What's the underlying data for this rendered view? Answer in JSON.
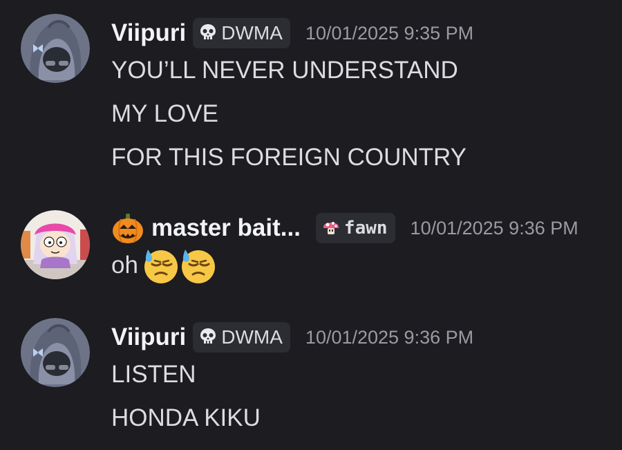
{
  "messages": [
    {
      "author": "Viipuri",
      "tag": "DWMA",
      "tag_icon": "skull-icon",
      "timestamp": "10/01/2025 9:35 PM",
      "lines": [
        "YOU’LL NEVER UNDERSTAND",
        "MY LOVE",
        "FOR THIS FOREIGN COUNTRY"
      ]
    },
    {
      "author_prefix_icon": "jack-o-lantern-icon",
      "author": "master bait...",
      "tag": "fawn",
      "tag_icon": "mushroom-icon",
      "timestamp": "10/01/2025 9:36 PM",
      "lines": [
        "oh"
      ],
      "emojis": [
        "downcast-face-with-sweat-icon",
        "downcast-face-with-sweat-icon"
      ]
    },
    {
      "author": "Viipuri",
      "tag": "DWMA",
      "tag_icon": "skull-icon",
      "timestamp": "10/01/2025 9:36 PM",
      "lines": [
        "LISTEN",
        "HONDA KIKU"
      ]
    }
  ],
  "colors": {
    "background": "#1c1c21",
    "username": "#f2f3f5",
    "text": "#dcdde1",
    "timestamp": "#9a9ba3",
    "tag_bg": "#2b2d33"
  }
}
